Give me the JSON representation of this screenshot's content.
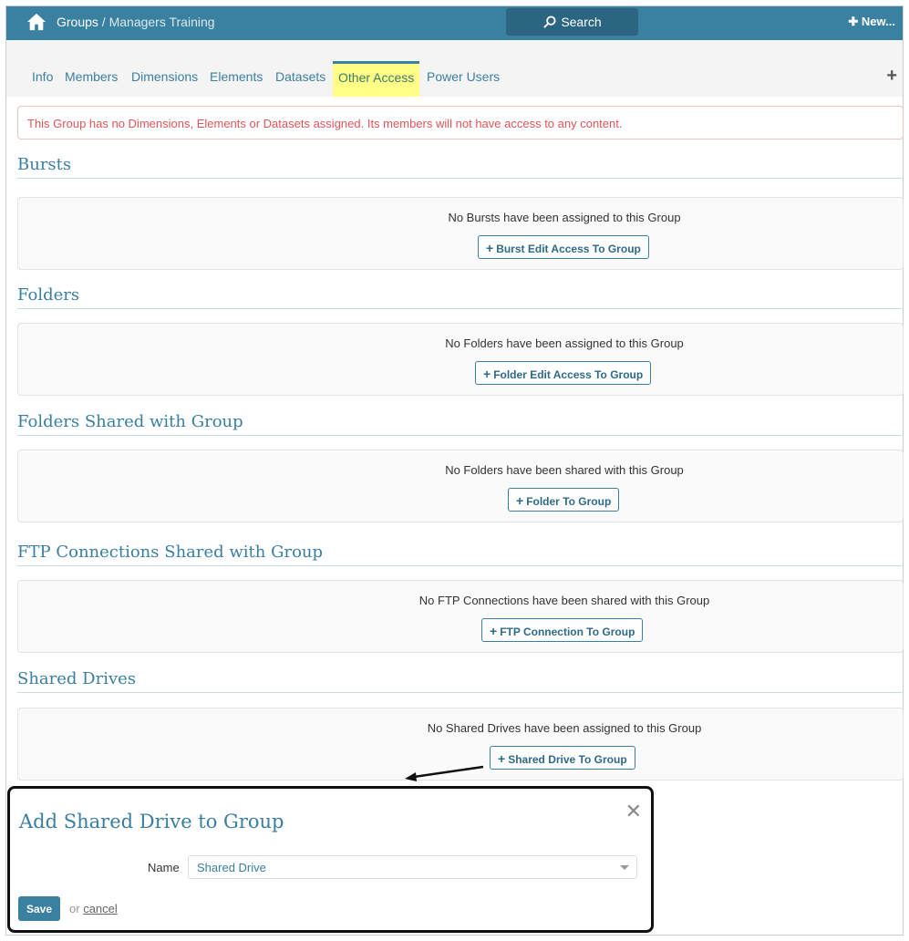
{
  "header": {
    "crumb_root": "Groups",
    "crumb_sep": " / ",
    "crumb_current": "Managers Training",
    "search_label": "Search",
    "new_label": "New..."
  },
  "tabs": [
    {
      "label": "Info"
    },
    {
      "label": "Members"
    },
    {
      "label": "Dimensions"
    },
    {
      "label": "Elements"
    },
    {
      "label": "Datasets"
    },
    {
      "label": "Other Access",
      "active": true
    },
    {
      "label": "Power Users"
    }
  ],
  "alert": "This Group has no Dimensions, Elements or Datasets assigned. Its members will not have access to any content.",
  "sections": [
    {
      "title": "Bursts",
      "message": "No Bursts have been assigned to this Group",
      "button": "Burst Edit Access To Group"
    },
    {
      "title": "Folders",
      "message": "No Folders have been assigned to this Group",
      "button": "Folder Edit Access To Group"
    },
    {
      "title": "Folders Shared with Group",
      "message": "No Folders have been shared with this Group",
      "button": "Folder To Group"
    },
    {
      "title": "FTP Connections Shared with Group",
      "message": "No FTP Connections have been shared with this Group",
      "button": "FTP Connection To Group"
    },
    {
      "title": "Shared Drives",
      "message": "No Shared Drives have been assigned to this Group",
      "button": "Shared Drive To Group"
    }
  ],
  "modal": {
    "title": "Add Shared Drive to Group",
    "name_label": "Name",
    "name_value": "Shared Drive",
    "save": "Save",
    "or": "or",
    "cancel": "cancel"
  },
  "colors": {
    "brand": "#3a80a0",
    "highlight": "#ffff88",
    "alert": "#e0555a"
  }
}
